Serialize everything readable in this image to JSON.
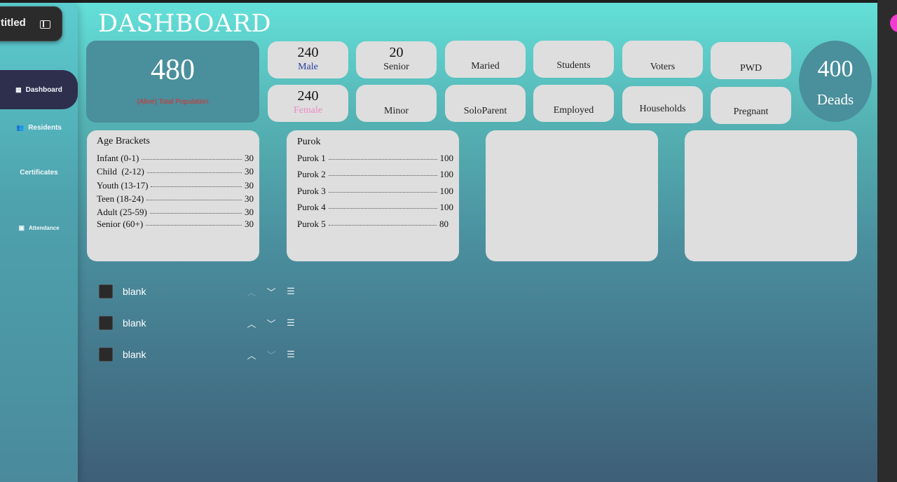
{
  "window": {
    "partial_title": "titled"
  },
  "sidebar": {
    "items": [
      {
        "label": "Dashboard",
        "icon": "grid-icon",
        "active": true
      },
      {
        "label": "Residents",
        "icon": "users-icon",
        "active": false
      },
      {
        "label": "Certificates",
        "icon": "",
        "active": false
      },
      {
        "label": "Attendance",
        "icon": "calendar-icon",
        "active": false
      }
    ]
  },
  "page": {
    "title": "DASHBOARD"
  },
  "total": {
    "number": "480",
    "label": "(Alive) Total Population"
  },
  "stats": {
    "male": {
      "number": "240",
      "label": "Male"
    },
    "female": {
      "number": "240",
      "label": "Female"
    },
    "senior": {
      "number": "20",
      "label": "Senior"
    },
    "minor": {
      "label": "Minor"
    },
    "maried": {
      "label": "Maried"
    },
    "soloparent": {
      "label": "SoloParent"
    },
    "students": {
      "label": "Students"
    },
    "employed": {
      "label": "Employed"
    },
    "voters": {
      "label": "Voters"
    },
    "households": {
      "label": "Households"
    },
    "pwd": {
      "label": "PWD"
    },
    "pregnant": {
      "label": "Pregnant"
    }
  },
  "deads": {
    "number": "400",
    "label": "Deads"
  },
  "age_brackets": {
    "title": "Age Brackets",
    "rows": [
      {
        "label": "Infant (0-1)",
        "value": "30"
      },
      {
        "label": "Child  (2-12)",
        "value": "30"
      },
      {
        "label": "Youth (13-17)",
        "value": "30"
      },
      {
        "label": "Teen (18-24)",
        "value": "30"
      },
      {
        "label": "Adult (25-59)",
        "value": "30"
      },
      {
        "label": "Senior (60+)",
        "value": "30"
      }
    ]
  },
  "purok": {
    "title": "Purok",
    "rows": [
      {
        "label": "Purok 1",
        "value": "100"
      },
      {
        "label": "Purok 2",
        "value": "100"
      },
      {
        "label": "Purok 3",
        "value": "100"
      },
      {
        "label": "Purok 4",
        "value": "100"
      },
      {
        "label": "Purok 5",
        "value": "80"
      }
    ]
  },
  "layers": [
    {
      "name": "blank"
    },
    {
      "name": "blank"
    },
    {
      "name": "blank"
    }
  ],
  "colors": {
    "accent": "#4a8f9c",
    "nav_active": "#2e2f4d",
    "card": "#dedede",
    "total_label": "#d8302c",
    "male": "#2b3fa0",
    "female": "#ee8bc6"
  }
}
